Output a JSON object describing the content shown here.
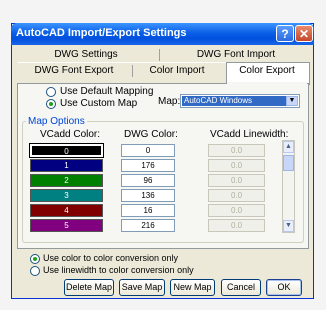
{
  "window": {
    "title": "AutoCAD Import/Export Settings",
    "help_label": "?",
    "close_label": "✕"
  },
  "tabs": {
    "row1": [
      "DWG Settings",
      "DWG Font Import"
    ],
    "row2": [
      "DWG Font Export",
      "Color Import",
      "Color Export"
    ],
    "active": "Color Export"
  },
  "mapping": {
    "default_label": "Use Default Mapping",
    "custom_label": "Use Custom Map",
    "selected": "custom",
    "map_label": "Map:",
    "map_value": "AutoCAD Windows"
  },
  "map_options": {
    "group_label": "Map Options",
    "col_vcadd": "VCadd Color:",
    "col_dwg": "DWG Color:",
    "col_lw": "VCadd Linewidth:",
    "rows": [
      {
        "vcadd": "0",
        "color": "#000000",
        "dwg": "0",
        "lw": "0.0",
        "selected": true
      },
      {
        "vcadd": "1",
        "color": "#000080",
        "dwg": "176",
        "lw": "0.0"
      },
      {
        "vcadd": "2",
        "color": "#008000",
        "dwg": "96",
        "lw": "0.0"
      },
      {
        "vcadd": "3",
        "color": "#008080",
        "dwg": "136",
        "lw": "0.0"
      },
      {
        "vcadd": "4",
        "color": "#800000",
        "dwg": "16",
        "lw": "0.0"
      },
      {
        "vcadd": "5",
        "color": "#800080",
        "dwg": "216",
        "lw": "0.0"
      }
    ]
  },
  "conversion": {
    "color_label": "Use color to color conversion only",
    "linewidth_label": "Use linewidth to color conversion only",
    "selected": "color"
  },
  "buttons": {
    "delete": "Delete Map",
    "save": "Save Map",
    "new": "New Map",
    "cancel": "Cancel",
    "ok": "OK"
  }
}
